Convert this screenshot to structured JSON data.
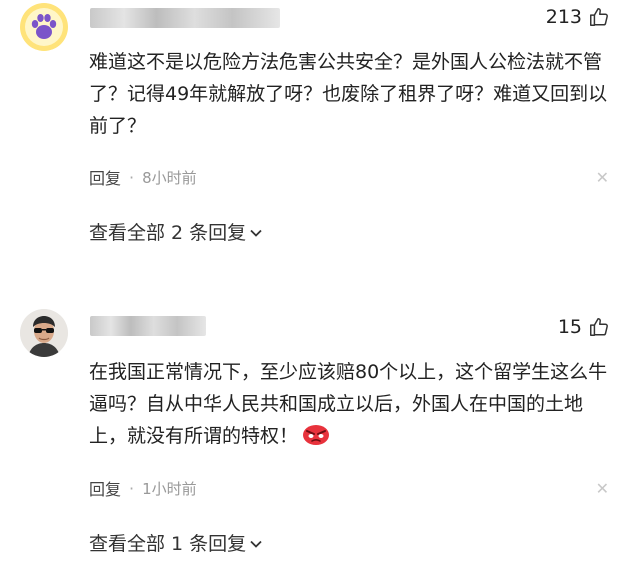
{
  "comments": [
    {
      "avatar_icon": "cat-paw-avatar-icon",
      "likes": "213",
      "text": "难道这不是以危险方法危害公共安全？是外国人公检法就不管了？记得49年就解放了呀？也废除了租界了呀？难道又回到以前了？",
      "reply_label": "回复",
      "time": "8小时前",
      "view_replies": "查看全部 2 条回复"
    },
    {
      "avatar_icon": "man-with-sunglasses-avatar-icon",
      "likes": "15",
      "text": "在我国正常情况下，至少应该赔80个以上，这个留学生这么牛逼吗？自从中华人民共和国成立以后，外国人在中国的土地上，就没有所谓的特权！",
      "emoji": "angry-face-emoji-icon",
      "reply_label": "回复",
      "time": "1小时前",
      "view_replies": "查看全部 1 条回复"
    }
  ],
  "colors": {
    "blur": "#cccccc",
    "time": "#999999",
    "close": "#c8c8c8",
    "avatar1_bg": "#ffe37a",
    "avatar1_paw": "#7b54c9",
    "emoji_red": "#e8323c"
  }
}
